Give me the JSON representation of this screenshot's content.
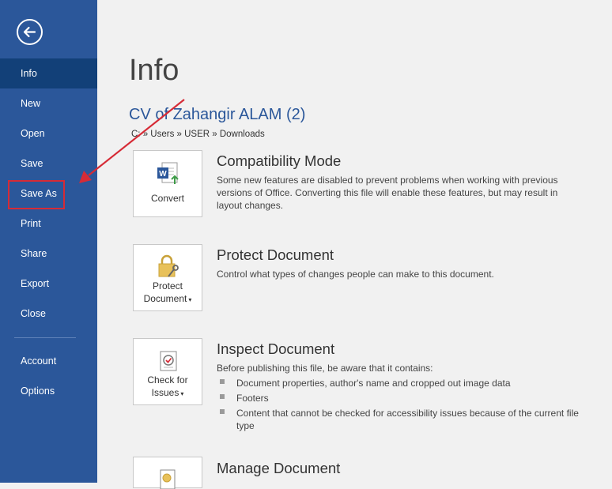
{
  "sidebar": {
    "items": [
      {
        "label": "Info"
      },
      {
        "label": "New"
      },
      {
        "label": "Open"
      },
      {
        "label": "Save"
      },
      {
        "label": "Save As"
      },
      {
        "label": "Print"
      },
      {
        "label": "Share"
      },
      {
        "label": "Export"
      },
      {
        "label": "Close"
      },
      {
        "label": "Account"
      },
      {
        "label": "Options"
      }
    ]
  },
  "main": {
    "title": "Info",
    "doc_name": "CV of Zahangir ALAM (2)",
    "doc_path": "C: » Users » USER » Downloads",
    "compat": {
      "button_label": "Convert",
      "title": "Compatibility Mode",
      "desc": "Some new features are disabled to prevent problems when working with previous versions of Office. Converting this file will enable these features, but may result in layout changes."
    },
    "protect": {
      "button_line1": "Protect",
      "button_line2": "Document",
      "title": "Protect Document",
      "desc": "Control what types of changes people can make to this document."
    },
    "inspect": {
      "button_line1": "Check for",
      "button_line2": "Issues",
      "title": "Inspect Document",
      "desc": "Before publishing this file, be aware that it contains:",
      "bullets": [
        "Document properties, author's name and cropped out image data",
        "Footers",
        "Content that cannot be checked for accessibility issues because of the current file type"
      ]
    },
    "manage": {
      "title": "Manage Document"
    }
  },
  "colors": {
    "sidebar": "#2b579a",
    "sidebar_active": "#124078",
    "accent": "#2b579a",
    "highlight": "#d62b36"
  }
}
